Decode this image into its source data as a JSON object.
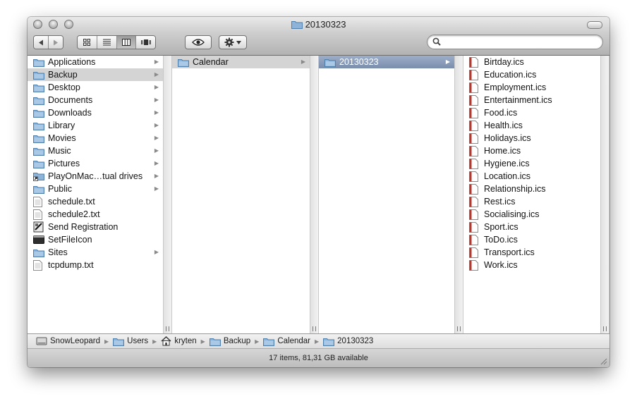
{
  "window": {
    "title": "20130323"
  },
  "toolbar": {
    "back_icon": "back-arrow-icon",
    "forward_icon": "forward-arrow-icon",
    "view_modes": [
      "icon-view",
      "list-view",
      "column-view",
      "coverflow-view"
    ],
    "active_view": "column-view",
    "quicklook_icon": "eye-icon",
    "action_icon": "gear-icon",
    "search": {
      "value": "",
      "placeholder": ""
    }
  },
  "columns": [
    {
      "items": [
        {
          "label": "Applications",
          "icon": "folder",
          "arrow": true
        },
        {
          "label": "Backup",
          "icon": "folder",
          "arrow": true,
          "selected": "inactive"
        },
        {
          "label": "Desktop",
          "icon": "folder",
          "arrow": true
        },
        {
          "label": "Documents",
          "icon": "folder",
          "arrow": true
        },
        {
          "label": "Downloads",
          "icon": "folder",
          "arrow": true
        },
        {
          "label": "Library",
          "icon": "folder",
          "arrow": true
        },
        {
          "label": "Movies",
          "icon": "folder",
          "arrow": true
        },
        {
          "label": "Music",
          "icon": "folder",
          "arrow": true
        },
        {
          "label": "Pictures",
          "icon": "folder",
          "arrow": true
        },
        {
          "label": "PlayOnMac…tual drives",
          "icon": "alias",
          "arrow": true
        },
        {
          "label": "Public",
          "icon": "folder",
          "arrow": true
        },
        {
          "label": "schedule.txt",
          "icon": "text",
          "arrow": false
        },
        {
          "label": "schedule2.txt",
          "icon": "text",
          "arrow": false
        },
        {
          "label": "Send Registration",
          "icon": "app",
          "arrow": false
        },
        {
          "label": "SetFileIcon",
          "icon": "exec",
          "arrow": false
        },
        {
          "label": "Sites",
          "icon": "folder",
          "arrow": true
        },
        {
          "label": "tcpdump.txt",
          "icon": "text",
          "arrow": false
        }
      ]
    },
    {
      "items": [
        {
          "label": "Calendar",
          "icon": "folder",
          "arrow": true,
          "selected": "inactive"
        }
      ]
    },
    {
      "items": [
        {
          "label": "20130323",
          "icon": "folder",
          "arrow": true,
          "selected": "active"
        }
      ]
    },
    {
      "items": [
        {
          "label": "Birtday.ics",
          "icon": "ics"
        },
        {
          "label": "Education.ics",
          "icon": "ics"
        },
        {
          "label": "Employment.ics",
          "icon": "ics"
        },
        {
          "label": "Entertainment.ics",
          "icon": "ics"
        },
        {
          "label": "Food.ics",
          "icon": "ics"
        },
        {
          "label": "Health.ics",
          "icon": "ics"
        },
        {
          "label": "Holidays.ics",
          "icon": "ics"
        },
        {
          "label": "Home.ics",
          "icon": "ics"
        },
        {
          "label": "Hygiene.ics",
          "icon": "ics"
        },
        {
          "label": "Location.ics",
          "icon": "ics"
        },
        {
          "label": "Relationship.ics",
          "icon": "ics"
        },
        {
          "label": "Rest.ics",
          "icon": "ics"
        },
        {
          "label": "Socialising.ics",
          "icon": "ics"
        },
        {
          "label": "Sport.ics",
          "icon": "ics"
        },
        {
          "label": "ToDo.ics",
          "icon": "ics"
        },
        {
          "label": "Transport.ics",
          "icon": "ics"
        },
        {
          "label": "Work.ics",
          "icon": "ics"
        }
      ]
    }
  ],
  "pathbar": [
    {
      "label": "SnowLeopard",
      "icon": "disk"
    },
    {
      "label": "Users",
      "icon": "folder"
    },
    {
      "label": "kryten",
      "icon": "home"
    },
    {
      "label": "Backup",
      "icon": "folder"
    },
    {
      "label": "Calendar",
      "icon": "folder"
    },
    {
      "label": "20130323",
      "icon": "folder"
    }
  ],
  "status": {
    "text": "17 items, 81,31 GB available"
  },
  "colors": {
    "selection_active": "#7a8dab",
    "selection_inactive": "#d4d4d4",
    "folder_blue": "#8db4d8",
    "ics_red": "#b5382f"
  }
}
